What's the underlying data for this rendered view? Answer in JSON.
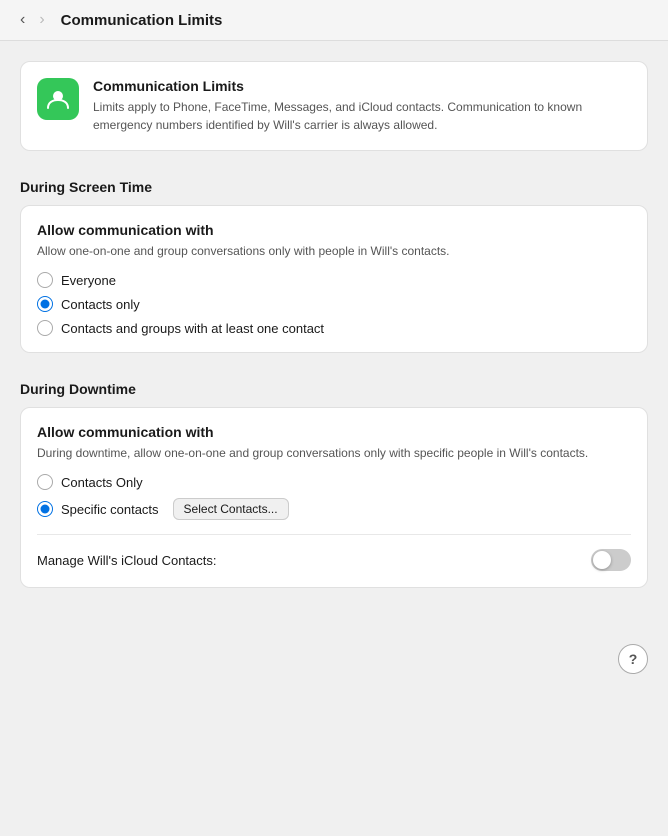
{
  "nav": {
    "back_label": "‹",
    "forward_label": "›",
    "title": "Communication Limits"
  },
  "info_card": {
    "title": "Communication Limits",
    "description": "Limits apply to Phone, FaceTime, Messages, and iCloud contacts. Communication to known emergency numbers identified by Will's carrier is always allowed."
  },
  "screen_time": {
    "section_label": "During Screen Time",
    "card_title": "Allow communication with",
    "card_desc": "Allow one-on-one and group conversations only with people in Will's contacts.",
    "options": [
      {
        "id": "st-everyone",
        "label": "Everyone",
        "checked": false
      },
      {
        "id": "st-contacts-only",
        "label": "Contacts only",
        "checked": true
      },
      {
        "id": "st-contacts-groups",
        "label": "Contacts and groups with at least one contact",
        "checked": false
      }
    ]
  },
  "downtime": {
    "section_label": "During Downtime",
    "card_title": "Allow communication with",
    "card_desc": "During downtime, allow one-on-one and group conversations only with specific people in Will's contacts.",
    "options": [
      {
        "id": "dt-contacts-only",
        "label": "Contacts Only",
        "checked": false
      },
      {
        "id": "dt-specific",
        "label": "Specific contacts",
        "checked": true
      }
    ],
    "select_contacts_btn": "Select Contacts...",
    "manage_label": "Manage Will's iCloud Contacts:",
    "toggle_checked": false
  },
  "help_btn_label": "?"
}
